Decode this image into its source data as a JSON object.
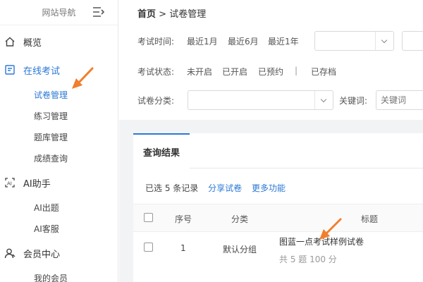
{
  "sidebar": {
    "nav_title": "网站导航",
    "items": [
      {
        "label": "概览"
      },
      {
        "label": "在线考试"
      },
      {
        "label": "AI助手"
      },
      {
        "label": "会员中心"
      }
    ],
    "exam_sub": [
      "试卷管理",
      "练习管理",
      "题库管理",
      "成绩查询"
    ],
    "ai_sub": [
      "AI出题",
      "AI客服"
    ],
    "member_sub": [
      "我的会员"
    ]
  },
  "breadcrumb": {
    "home": "首页",
    "sep": ">",
    "current": "试卷管理"
  },
  "filters": {
    "time_label": "考试时间:",
    "time_opts": [
      "最近1月",
      "最近6月",
      "最近1年"
    ],
    "status_label": "考试状态:",
    "status_opts": [
      "未开启",
      "已开启",
      "已预约",
      "|",
      "已存档"
    ],
    "category_label": "试卷分类:",
    "keyword_label": "关键词:",
    "keyword_placeholder": "关键词"
  },
  "results": {
    "tab": "查询结果",
    "selected": "已选 5 条记录",
    "share": "分享试卷",
    "more": "更多功能",
    "columns": [
      "序号",
      "分类",
      "标题"
    ],
    "rows": [
      {
        "index": "1",
        "category": "默认分组",
        "title": "图蓝一点考试样例试卷",
        "meta": "共 5 题 100 分"
      }
    ]
  },
  "colors": {
    "accent": "#2b78d6",
    "annotation": "#f07f2e"
  }
}
